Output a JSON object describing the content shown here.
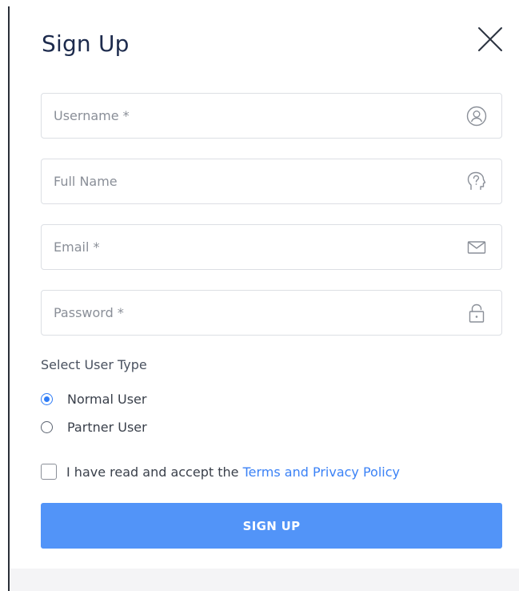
{
  "dialog": {
    "title": "Sign Up",
    "close_icon": "close-icon"
  },
  "fields": {
    "username": {
      "placeholder": "Username *",
      "value": "",
      "icon": "user-circle-icon"
    },
    "full_name": {
      "placeholder": "Full Name",
      "value": "",
      "icon": "head-question-icon"
    },
    "email": {
      "placeholder": "Email *",
      "value": "",
      "icon": "envelope-icon"
    },
    "password": {
      "placeholder": "Password *",
      "value": "",
      "icon": "lock-icon"
    }
  },
  "user_type": {
    "label": "Select User Type",
    "options": [
      {
        "label": "Normal User",
        "selected": true
      },
      {
        "label": "Partner User",
        "selected": false
      }
    ]
  },
  "terms": {
    "text": "I have read and accept the ",
    "link": "Terms and Privacy Policy",
    "checked": false
  },
  "submit": {
    "label": "SIGN UP"
  },
  "colors": {
    "accent": "#2f7cf6",
    "button": "#5294f8",
    "link": "#3b82f6",
    "title": "#1d2b4d"
  }
}
